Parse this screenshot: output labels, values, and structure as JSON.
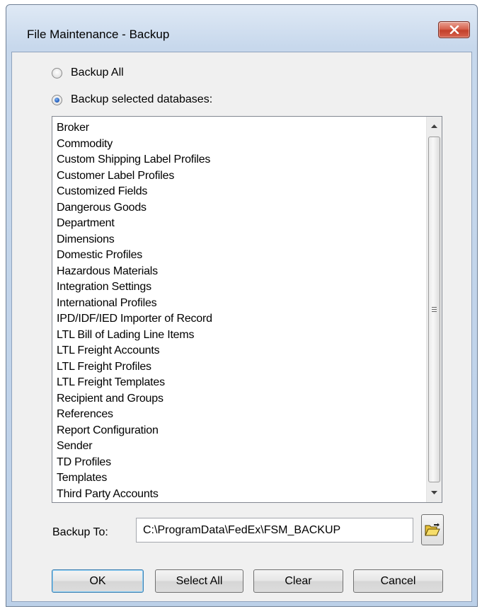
{
  "window": {
    "title": "File Maintenance - Backup"
  },
  "options": {
    "backup_all_label": "Backup All",
    "backup_selected_label": "Backup selected databases:",
    "selected": "backup_selected"
  },
  "databases": [
    "Broker",
    "Commodity",
    "Custom Shipping Label Profiles",
    "Customer Label Profiles",
    "Customized Fields",
    "Dangerous Goods",
    "Department",
    "Dimensions",
    "Domestic Profiles",
    "Hazardous Materials",
    "Integration Settings",
    "International Profiles",
    "IPD/IDF/IED Importer of Record",
    "LTL Bill of Lading Line Items",
    "LTL Freight Accounts",
    "LTL Freight Profiles",
    "LTL Freight Templates",
    "Recipient and Groups",
    "References",
    "Report Configuration",
    "Sender",
    "TD Profiles",
    "Templates",
    "Third Party Accounts"
  ],
  "backup_to": {
    "label": "Backup To:",
    "path": "C:\\ProgramData\\FedEx\\FSM_BACKUP"
  },
  "buttons": {
    "ok": "OK",
    "select_all": "Select All",
    "clear": "Clear",
    "cancel": "Cancel"
  },
  "icons": {
    "close": "close-icon",
    "scroll_up": "scroll-up-arrow-icon",
    "scroll_down": "scroll-down-arrow-icon",
    "browse": "open-folder-icon"
  }
}
